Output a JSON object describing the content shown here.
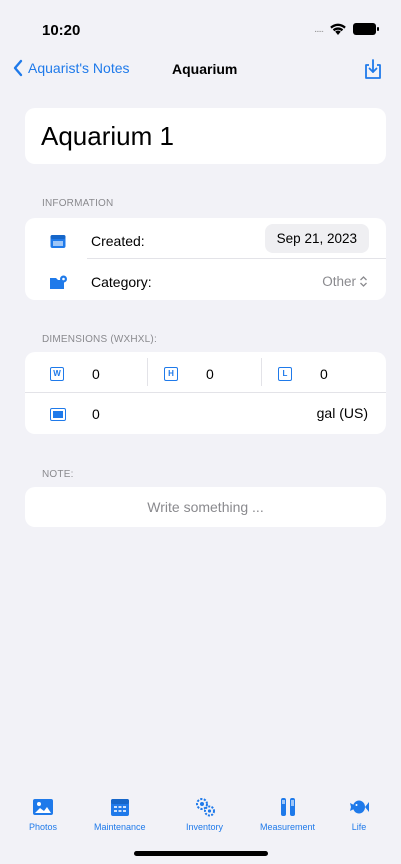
{
  "status": {
    "time": "10:20",
    "signal": "....."
  },
  "nav": {
    "back_label": "Aquarist's Notes",
    "title": "Aquarium"
  },
  "title_card": {
    "name": "Aquarium 1"
  },
  "information": {
    "header": "INFORMATION",
    "created_label": "Created:",
    "created_value": "Sep 21, 2023",
    "category_label": "Category:",
    "category_value": "Other"
  },
  "dimensions": {
    "header": "DIMENSIONS (WXHXL):",
    "width_icon_letter": "W",
    "width_value": "0",
    "height_icon_letter": "H",
    "height_value": "0",
    "length_icon_letter": "L",
    "length_value": "0",
    "volume_value": "0",
    "volume_unit": "gal (US)"
  },
  "note": {
    "header": "NOTE:",
    "placeholder": "Write something ..."
  },
  "tabs": [
    {
      "label": "Photos",
      "icon": "photo-icon"
    },
    {
      "label": "Maintenance",
      "icon": "calendar-icon"
    },
    {
      "label": "Inventory",
      "icon": "gears-icon"
    },
    {
      "label": "Measurement",
      "icon": "test-tubes-icon"
    },
    {
      "label": "Life",
      "icon": "fish-icon"
    }
  ],
  "colors": {
    "accent": "#1f7aea",
    "background": "#f2f2f7",
    "card": "#ffffff",
    "secondary_text": "#8a8a8e"
  }
}
